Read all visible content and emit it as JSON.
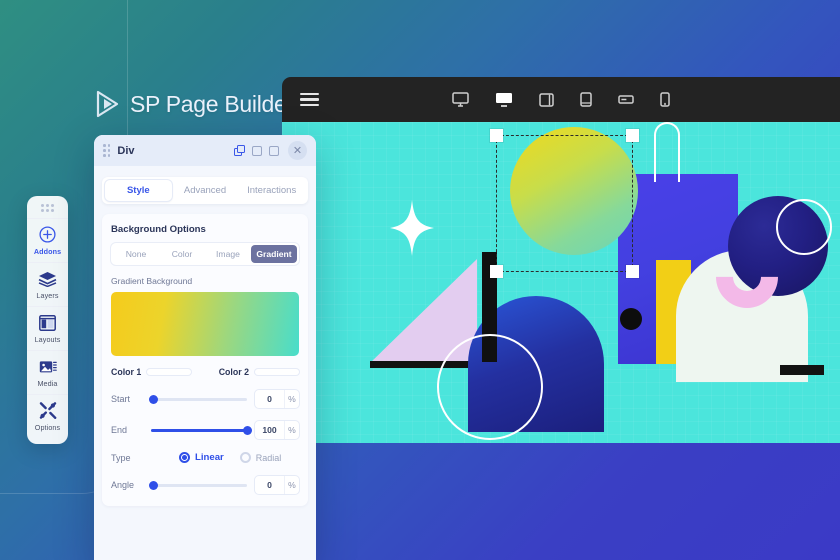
{
  "brand": {
    "name": "SP Page Builder",
    "logo_icon": "play-chevron-logo-icon"
  },
  "topbar": {
    "menu_icon": "hamburger-menu-icon",
    "devices": [
      {
        "name": "desktop-icon",
        "label": "Desktop",
        "active": false
      },
      {
        "name": "large-desktop-icon",
        "label": "Large Desktop",
        "active": true
      },
      {
        "name": "tablet-landscape-icon",
        "label": "Tablet Landscape",
        "active": false
      },
      {
        "name": "tablet-icon",
        "label": "Tablet",
        "active": false
      },
      {
        "name": "mobile-landscape-icon",
        "label": "Mobile Landscape",
        "active": false
      },
      {
        "name": "mobile-icon",
        "label": "Mobile",
        "active": false
      }
    ]
  },
  "rail": {
    "items": [
      {
        "label": "Addons",
        "icon": "plus-circle-icon",
        "active": true
      },
      {
        "label": "Layers",
        "icon": "layers-stack-icon",
        "active": false
      },
      {
        "label": "Layouts",
        "icon": "layouts-grid-icon",
        "active": false
      },
      {
        "label": "Media",
        "icon": "media-image-icon",
        "active": false
      },
      {
        "label": "Options",
        "icon": "tools-wrench-icon",
        "active": false
      }
    ]
  },
  "panel": {
    "title": "Div",
    "drag_handle_icon": "drag-dots-icon",
    "actions": [
      {
        "name": "duplicate-icon",
        "label": "Duplicate"
      },
      {
        "name": "square-outline-icon",
        "label": "Restore"
      },
      {
        "name": "square-outline-icon",
        "label": "Maximize"
      }
    ],
    "close_label": "✕",
    "tabs": [
      {
        "label": "Style",
        "active": true
      },
      {
        "label": "Advanced",
        "active": false
      },
      {
        "label": "Interactions",
        "active": false
      }
    ],
    "background": {
      "card_title": "Background Options",
      "segments": [
        {
          "label": "None",
          "active": false
        },
        {
          "label": "Color",
          "active": false
        },
        {
          "label": "Image",
          "active": false
        },
        {
          "label": "Gradient",
          "active": true
        }
      ],
      "gradient_label": "Gradient  Background",
      "color1": {
        "label": "Color 1",
        "hex": "#f5cb1c"
      },
      "color2": {
        "label": "Color 2",
        "hex": "#48ddcb"
      },
      "start": {
        "label": "Start",
        "value": "0",
        "unit": "%",
        "pct": 3
      },
      "end": {
        "label": "End",
        "value": "100",
        "unit": "%",
        "pct": 100
      },
      "type": {
        "label": "Type",
        "options": [
          {
            "label": "Linear",
            "selected": true
          },
          {
            "label": "Radial",
            "selected": false
          }
        ]
      },
      "angle": {
        "label": "Angle",
        "value": "0",
        "unit": "%",
        "pct": 3
      }
    }
  },
  "canvas": {
    "selected_shape": "gradient-circle",
    "grid_visible": true
  }
}
